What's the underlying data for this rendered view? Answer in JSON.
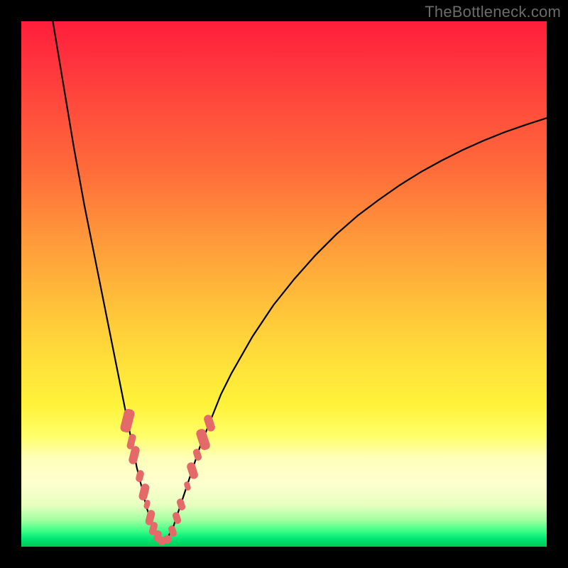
{
  "watermark": "TheBottleneck.com",
  "colors": {
    "frame": "#000000",
    "curve": "#000000",
    "point": "#e46a6a"
  },
  "chart_data": {
    "type": "line",
    "title": "",
    "xlabel": "",
    "ylabel": "",
    "xlim": [
      0,
      100
    ],
    "ylim": [
      0,
      100
    ],
    "series": [
      {
        "name": "left-branch",
        "x": [
          6,
          8,
          10,
          12,
          14,
          16,
          18,
          19,
          20,
          21,
          22,
          23,
          23.7,
          24.3,
          25,
          25.6,
          26.1,
          26.7,
          27.1
        ],
        "y": [
          100,
          88,
          76,
          65,
          55,
          45,
          35,
          30,
          25,
          20,
          15,
          11,
          8,
          6,
          4,
          3,
          2,
          1.3,
          1
        ]
      },
      {
        "name": "right-branch",
        "x": [
          27.1,
          28,
          29,
          30,
          31,
          32,
          33,
          34,
          36,
          38,
          40,
          44,
          48,
          52,
          56,
          60,
          64,
          68,
          72,
          76,
          80,
          84,
          88,
          92,
          96,
          100
        ],
        "y": [
          1,
          2,
          4,
          7,
          10,
          13,
          16,
          19,
          24,
          29,
          33,
          40,
          46,
          51,
          55.5,
          59.5,
          63,
          66,
          68.8,
          71.3,
          73.5,
          75.5,
          77.3,
          78.9,
          80.3,
          81.6
        ]
      }
    ],
    "points_on_curve": [
      {
        "branch": "left",
        "x": 20.2,
        "y": 24,
        "w": 2.0,
        "h": 4.5
      },
      {
        "branch": "left",
        "x": 20.9,
        "y": 20,
        "w": 1.4,
        "h": 3.0
      },
      {
        "branch": "left",
        "x": 21.5,
        "y": 17.5,
        "w": 1.6,
        "h": 3.5
      },
      {
        "branch": "left",
        "x": 22.5,
        "y": 13.5,
        "w": 1.3,
        "h": 2.3
      },
      {
        "branch": "left",
        "x": 23.3,
        "y": 10.5,
        "w": 1.6,
        "h": 3.2
      },
      {
        "branch": "left",
        "x": 23.9,
        "y": 8.0,
        "w": 1.1,
        "h": 1.8
      },
      {
        "branch": "left",
        "x": 24.5,
        "y": 5.5,
        "w": 1.5,
        "h": 3.0
      },
      {
        "branch": "left",
        "x": 25.2,
        "y": 3.5,
        "w": 1.4,
        "h": 2.5
      },
      {
        "branch": "left",
        "x": 25.9,
        "y": 2.0,
        "w": 1.4,
        "h": 2.2
      },
      {
        "branch": "bottom",
        "x": 26.8,
        "y": 1.1,
        "w": 1.6,
        "h": 1.6
      },
      {
        "branch": "bottom",
        "x": 27.8,
        "y": 1.4,
        "w": 1.6,
        "h": 1.6
      },
      {
        "branch": "right",
        "x": 28.8,
        "y": 3.0,
        "w": 1.4,
        "h": 2.2
      },
      {
        "branch": "right",
        "x": 29.6,
        "y": 5.5,
        "w": 1.4,
        "h": 2.3
      },
      {
        "branch": "right",
        "x": 30.4,
        "y": 8.0,
        "w": 1.4,
        "h": 2.3
      },
      {
        "branch": "right",
        "x": 31.6,
        "y": 11.5,
        "w": 1.1,
        "h": 1.8
      },
      {
        "branch": "right",
        "x": 32.6,
        "y": 14.5,
        "w": 1.6,
        "h": 3.2
      },
      {
        "branch": "right",
        "x": 33.5,
        "y": 17.5,
        "w": 1.3,
        "h": 2.3
      },
      {
        "branch": "right",
        "x": 34.6,
        "y": 20.5,
        "w": 1.9,
        "h": 4.0
      },
      {
        "branch": "right",
        "x": 35.8,
        "y": 23.5,
        "w": 1.6,
        "h": 3.2
      }
    ]
  }
}
